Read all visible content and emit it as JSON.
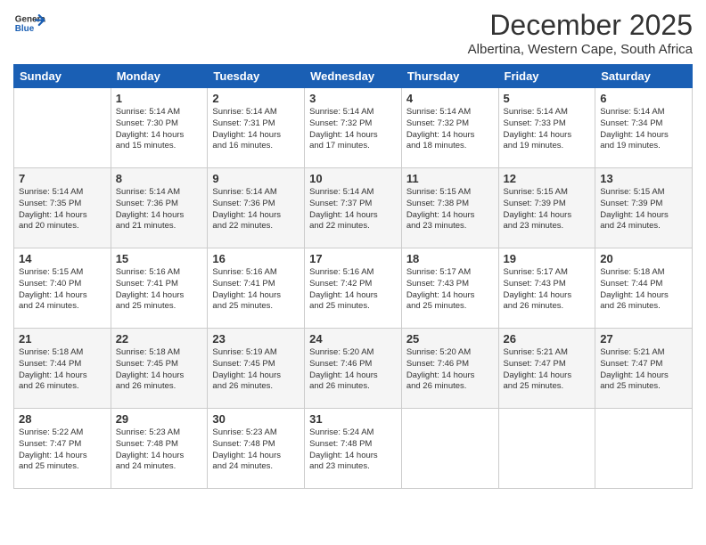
{
  "header": {
    "logo": {
      "general": "General",
      "blue": "Blue"
    },
    "month": "December 2025",
    "location": "Albertina, Western Cape, South Africa"
  },
  "weekdays": [
    "Sunday",
    "Monday",
    "Tuesday",
    "Wednesday",
    "Thursday",
    "Friday",
    "Saturday"
  ],
  "weeks": [
    [
      {
        "day": "",
        "info": ""
      },
      {
        "day": "1",
        "info": "Sunrise: 5:14 AM\nSunset: 7:30 PM\nDaylight: 14 hours\nand 15 minutes."
      },
      {
        "day": "2",
        "info": "Sunrise: 5:14 AM\nSunset: 7:31 PM\nDaylight: 14 hours\nand 16 minutes."
      },
      {
        "day": "3",
        "info": "Sunrise: 5:14 AM\nSunset: 7:32 PM\nDaylight: 14 hours\nand 17 minutes."
      },
      {
        "day": "4",
        "info": "Sunrise: 5:14 AM\nSunset: 7:32 PM\nDaylight: 14 hours\nand 18 minutes."
      },
      {
        "day": "5",
        "info": "Sunrise: 5:14 AM\nSunset: 7:33 PM\nDaylight: 14 hours\nand 19 minutes."
      },
      {
        "day": "6",
        "info": "Sunrise: 5:14 AM\nSunset: 7:34 PM\nDaylight: 14 hours\nand 19 minutes."
      }
    ],
    [
      {
        "day": "7",
        "info": "Sunrise: 5:14 AM\nSunset: 7:35 PM\nDaylight: 14 hours\nand 20 minutes."
      },
      {
        "day": "8",
        "info": "Sunrise: 5:14 AM\nSunset: 7:36 PM\nDaylight: 14 hours\nand 21 minutes."
      },
      {
        "day": "9",
        "info": "Sunrise: 5:14 AM\nSunset: 7:36 PM\nDaylight: 14 hours\nand 22 minutes."
      },
      {
        "day": "10",
        "info": "Sunrise: 5:14 AM\nSunset: 7:37 PM\nDaylight: 14 hours\nand 22 minutes."
      },
      {
        "day": "11",
        "info": "Sunrise: 5:15 AM\nSunset: 7:38 PM\nDaylight: 14 hours\nand 23 minutes."
      },
      {
        "day": "12",
        "info": "Sunrise: 5:15 AM\nSunset: 7:39 PM\nDaylight: 14 hours\nand 23 minutes."
      },
      {
        "day": "13",
        "info": "Sunrise: 5:15 AM\nSunset: 7:39 PM\nDaylight: 14 hours\nand 24 minutes."
      }
    ],
    [
      {
        "day": "14",
        "info": "Sunrise: 5:15 AM\nSunset: 7:40 PM\nDaylight: 14 hours\nand 24 minutes."
      },
      {
        "day": "15",
        "info": "Sunrise: 5:16 AM\nSunset: 7:41 PM\nDaylight: 14 hours\nand 25 minutes."
      },
      {
        "day": "16",
        "info": "Sunrise: 5:16 AM\nSunset: 7:41 PM\nDaylight: 14 hours\nand 25 minutes."
      },
      {
        "day": "17",
        "info": "Sunrise: 5:16 AM\nSunset: 7:42 PM\nDaylight: 14 hours\nand 25 minutes."
      },
      {
        "day": "18",
        "info": "Sunrise: 5:17 AM\nSunset: 7:43 PM\nDaylight: 14 hours\nand 25 minutes."
      },
      {
        "day": "19",
        "info": "Sunrise: 5:17 AM\nSunset: 7:43 PM\nDaylight: 14 hours\nand 26 minutes."
      },
      {
        "day": "20",
        "info": "Sunrise: 5:18 AM\nSunset: 7:44 PM\nDaylight: 14 hours\nand 26 minutes."
      }
    ],
    [
      {
        "day": "21",
        "info": "Sunrise: 5:18 AM\nSunset: 7:44 PM\nDaylight: 14 hours\nand 26 minutes."
      },
      {
        "day": "22",
        "info": "Sunrise: 5:18 AM\nSunset: 7:45 PM\nDaylight: 14 hours\nand 26 minutes."
      },
      {
        "day": "23",
        "info": "Sunrise: 5:19 AM\nSunset: 7:45 PM\nDaylight: 14 hours\nand 26 minutes."
      },
      {
        "day": "24",
        "info": "Sunrise: 5:20 AM\nSunset: 7:46 PM\nDaylight: 14 hours\nand 26 minutes."
      },
      {
        "day": "25",
        "info": "Sunrise: 5:20 AM\nSunset: 7:46 PM\nDaylight: 14 hours\nand 26 minutes."
      },
      {
        "day": "26",
        "info": "Sunrise: 5:21 AM\nSunset: 7:47 PM\nDaylight: 14 hours\nand 25 minutes."
      },
      {
        "day": "27",
        "info": "Sunrise: 5:21 AM\nSunset: 7:47 PM\nDaylight: 14 hours\nand 25 minutes."
      }
    ],
    [
      {
        "day": "28",
        "info": "Sunrise: 5:22 AM\nSunset: 7:47 PM\nDaylight: 14 hours\nand 25 minutes."
      },
      {
        "day": "29",
        "info": "Sunrise: 5:23 AM\nSunset: 7:48 PM\nDaylight: 14 hours\nand 24 minutes."
      },
      {
        "day": "30",
        "info": "Sunrise: 5:23 AM\nSunset: 7:48 PM\nDaylight: 14 hours\nand 24 minutes."
      },
      {
        "day": "31",
        "info": "Sunrise: 5:24 AM\nSunset: 7:48 PM\nDaylight: 14 hours\nand 23 minutes."
      },
      {
        "day": "",
        "info": ""
      },
      {
        "day": "",
        "info": ""
      },
      {
        "day": "",
        "info": ""
      }
    ]
  ]
}
